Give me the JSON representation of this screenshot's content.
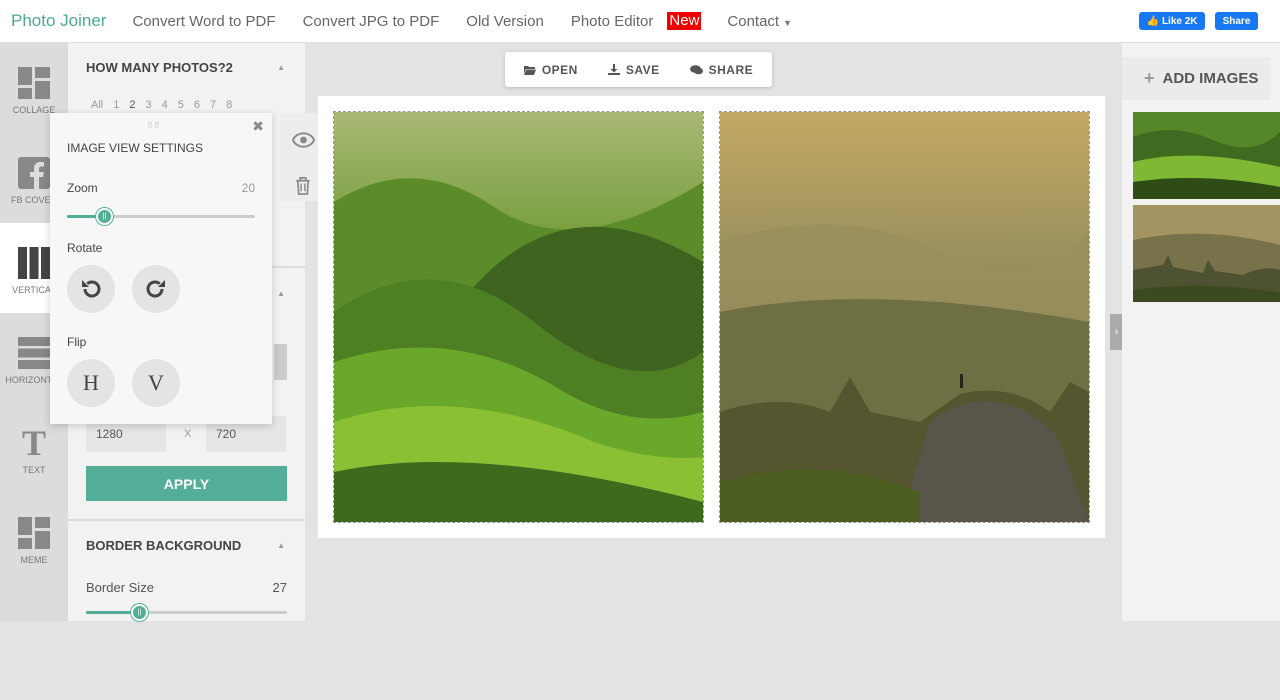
{
  "nav": {
    "brand": "Photo Joiner",
    "links": [
      "Convert Word to PDF",
      "Convert JPG to PDF",
      "Old Version",
      "Photo Editor"
    ],
    "new_badge": "New",
    "contact": "Contact",
    "fb_like": "Like 2K",
    "fb_share": "Share"
  },
  "rail": [
    {
      "label": "COLLAGE",
      "icon": "collage-icon"
    },
    {
      "label": "FB COVER",
      "icon": "facebook-icon"
    },
    {
      "label": "VERTICAL",
      "icon": "vertical-layout-icon"
    },
    {
      "label": "HORIZONTAL",
      "icon": "horizontal-layout-icon"
    },
    {
      "label": "TEXT",
      "icon": "text-icon"
    },
    {
      "label": "MEME",
      "icon": "meme-icon"
    }
  ],
  "settings": {
    "how_many_title": "HOW MANY PHOTOS?2",
    "counts": [
      "All",
      "1",
      "2",
      "3",
      "4",
      "5",
      "6",
      "7",
      "8"
    ],
    "selected_count": "2",
    "width": "1280",
    "x_sep": "X",
    "height": "720",
    "apply": "APPLY",
    "border_title": "BORDER BACKGROUND",
    "border_size_label": "Border Size",
    "border_size_value": "27",
    "border_size_fraction": 0.27
  },
  "popup": {
    "title": "IMAGE VIEW SETTINGS",
    "zoom_label": "Zoom",
    "zoom_value": "20",
    "zoom_fraction": 0.2,
    "rotate_label": "Rotate",
    "flip_label": "Flip",
    "flip_h": "H",
    "flip_v": "V"
  },
  "actions": {
    "open": "OPEN",
    "save": "SAVE",
    "share": "SHARE"
  },
  "right": {
    "add_images": "ADD IMAGES"
  },
  "colors": {
    "accent": "#54ae97",
    "brand": "#4fa896",
    "facebook": "#1877f2",
    "new_badge": "#e00000"
  }
}
